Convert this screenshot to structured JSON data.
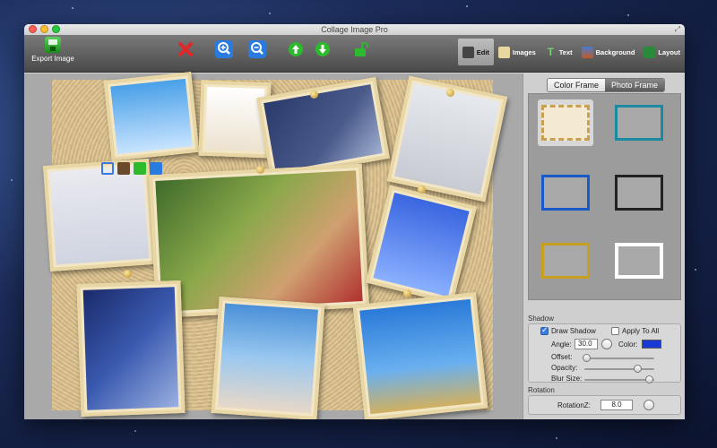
{
  "window": {
    "title": "Collage Image Pro"
  },
  "toolbar": {
    "export_label": "Export Image",
    "buttons": [
      {
        "name": "delete-button",
        "icon": "red-x-icon",
        "color": "#e02828"
      },
      {
        "name": "zoom-in-button",
        "icon": "zoom-in-icon",
        "color": "#2a7be0"
      },
      {
        "name": "zoom-out-button",
        "icon": "zoom-out-icon",
        "color": "#2a7be0"
      },
      {
        "name": "bring-forward-button",
        "icon": "arrow-up-icon",
        "color": "#2dbb2d"
      },
      {
        "name": "send-backward-button",
        "icon": "arrow-down-icon",
        "color": "#2dbb2d"
      },
      {
        "name": "unlock-button",
        "icon": "unlock-icon",
        "color": "#2dbb2d"
      }
    ]
  },
  "tabs": [
    {
      "label": "Edit",
      "active": true
    },
    {
      "label": "Images",
      "active": false
    },
    {
      "label": "Text",
      "active": false
    },
    {
      "label": "Background",
      "active": false
    },
    {
      "label": "Layout",
      "active": false
    }
  ],
  "sidebar": {
    "segments": [
      "Color Frame",
      "Photo Frame"
    ],
    "selected_segment": "Photo Frame",
    "shadow": {
      "title": "Shadow",
      "draw_shadow_label": "Draw Shadow",
      "draw_shadow_checked": true,
      "apply_to_all_label": "Apply To All",
      "apply_to_all_checked": false,
      "angle_label": "Angle:",
      "angle_value": "30.0",
      "color_label": "Color:",
      "color_value": "#1a3ad8",
      "offset_label": "Offset:",
      "offset_level": 0.02,
      "opacity_label": "Opacity:",
      "opacity_level": 0.75,
      "blur_label": "Blur Size:",
      "blur_level": 0.92
    },
    "rotation": {
      "title": "Rotation",
      "rotation_label": "RotationZ:",
      "rotation_value": "8.0"
    }
  }
}
